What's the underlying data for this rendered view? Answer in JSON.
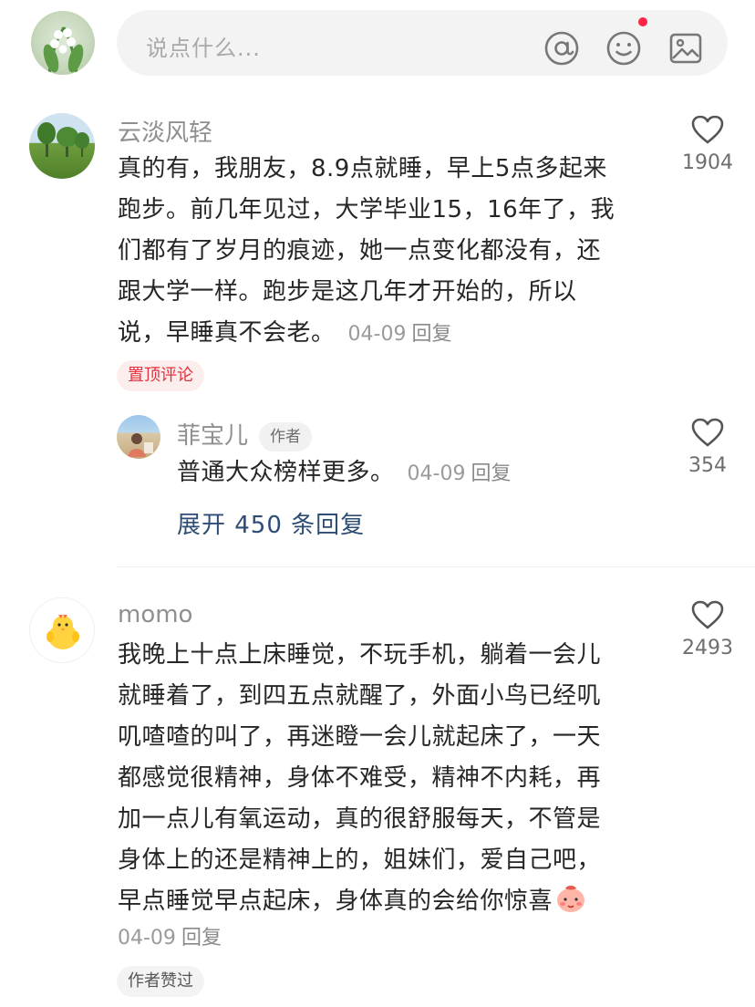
{
  "input_bar": {
    "placeholder": "说点什么...",
    "icons": [
      "at-icon",
      "emoji-icon",
      "image-icon"
    ]
  },
  "comments": [
    {
      "username": "云淡风轻",
      "lines": [
        "真的有，我朋友，8.9点就睡，早上5点多起来",
        "跑步。前几年见过，大学毕业15，16年了，我",
        "们都有了岁月的痕迹，她一点变化都没有，还",
        "跟大学一样。跑步是这几年才开始的，所以",
        "说，早睡真不会老。"
      ],
      "date": "04-09",
      "reply_label": "回复",
      "like_count": "1904",
      "tag": "置顶评论",
      "reply": {
        "username": "菲宝儿",
        "badge": "作者",
        "text": "普通大众榜样更多。",
        "date": "04-09",
        "reply_label": "回复",
        "like_count": "354"
      },
      "expand_label": "展开 450 条回复"
    },
    {
      "username": "momo",
      "lines": [
        "我晚上十点上床睡觉，不玩手机，躺着一会儿",
        "就睡着了，到四五点就醒了，外面小鸟已经叽",
        "叽喳喳的叫了，再迷瞪一会儿就起床了，一天",
        "都感觉很精神，身体不难受，精神不内耗，再",
        "加一点儿有氧运动，真的很舒服每天，不管是",
        "身体上的还是精神上的，姐妹们，爱自己吧，",
        "早点睡觉早点起床，身体真的会给你惊喜"
      ],
      "date": "04-09",
      "reply_label": "回复",
      "like_count": "2493",
      "tag": "作者赞过"
    }
  ],
  "colors": {
    "accent_red": "#ff2442",
    "link_blue": "#2d4d74",
    "muted_text": "#8f8f8f"
  }
}
